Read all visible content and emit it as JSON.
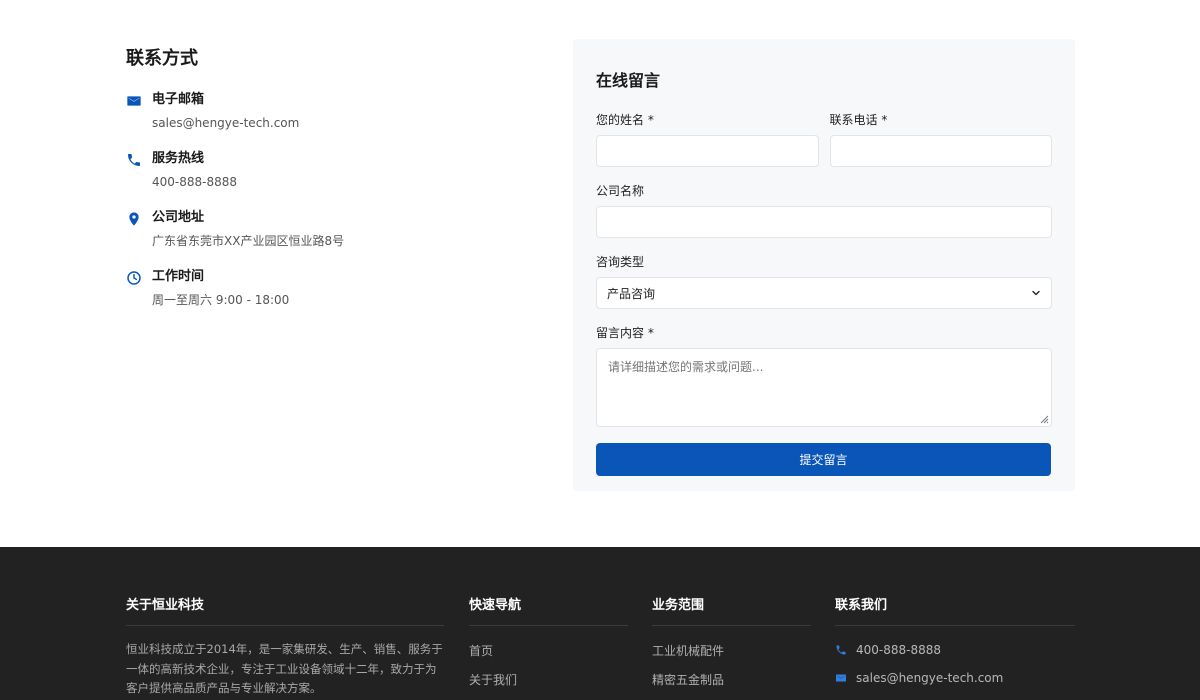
{
  "contact": {
    "title": "联系方式",
    "items": [
      {
        "icon": "mail-icon",
        "label": "电子邮箱",
        "value": "sales@hengye-tech.com"
      },
      {
        "icon": "phone-icon",
        "label": "服务热线",
        "value": "400-888-8888"
      },
      {
        "icon": "location-pin-icon",
        "label": "公司地址",
        "value": "广东省东莞市XX产业园区恒业路8号"
      },
      {
        "icon": "clock-icon",
        "label": "工作时间",
        "value": "周一至周六 9:00 - 18:00"
      }
    ]
  },
  "form": {
    "title": "在线留言",
    "name_label": "您的姓名 *",
    "phone_label": "联系电话 *",
    "company_label": "公司名称",
    "type_label": "咨询类型",
    "type_selected": "产品咨询",
    "message_label": "留言内容 *",
    "message_placeholder": "请详细描述您的需求或问题...",
    "submit_label": "提交留言"
  },
  "footer": {
    "about": {
      "heading": "关于恒业科技",
      "text": "恒业科技成立于2014年，是一家集研发、生产、销售、服务于一体的高新技术企业，专注于工业设备领域十二年，致力于为客户提供高品质产品与专业解决方案。"
    },
    "nav": {
      "heading": "快速导航",
      "links": [
        "首页",
        "关于我们"
      ]
    },
    "business": {
      "heading": "业务范围",
      "links": [
        "工业机械配件",
        "精密五金制品"
      ]
    },
    "contact": {
      "heading": "联系我们",
      "phone": "400-888-8888",
      "email": "sales@hengye-tech.com"
    }
  },
  "colors": {
    "accent": "#0a56b8",
    "footer_bg": "#222222",
    "panel_bg": "#f7f8fa"
  }
}
